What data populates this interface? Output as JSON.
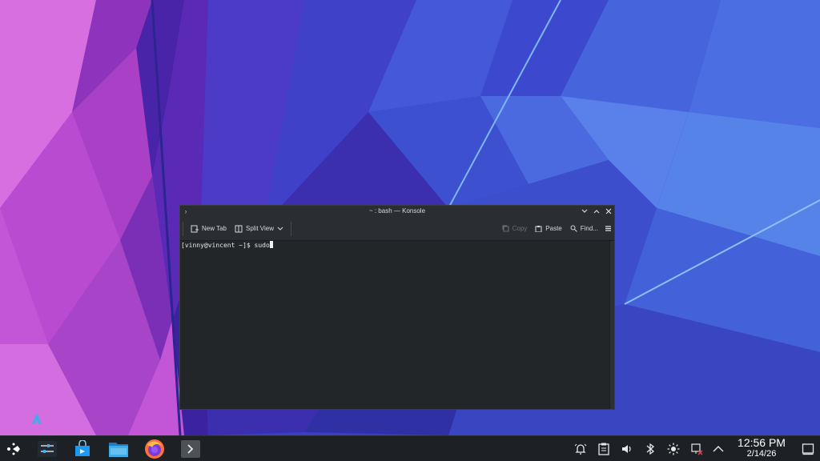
{
  "desktop": {
    "wallpaper_icon": "kde-plasma-wallpaper"
  },
  "window": {
    "title": "~ : bash — Konsole",
    "toolbar": {
      "new_tab": "New Tab",
      "split_view": "Split View",
      "copy": "Copy",
      "paste": "Paste",
      "find": "Find..."
    },
    "terminal": {
      "prompt": "[vinny@vincent ~]$ ",
      "input": "sudo"
    }
  },
  "taskbar": {
    "apps": [
      {
        "name": "application-launcher",
        "icon": "steamdeck-launcher-icon"
      },
      {
        "name": "system-settings",
        "icon": "settings-sliders-icon"
      },
      {
        "name": "discover",
        "icon": "shopping-bag-icon"
      },
      {
        "name": "dolphin",
        "icon": "folder-icon"
      },
      {
        "name": "firefox",
        "icon": "firefox-icon"
      },
      {
        "name": "konsole",
        "icon": "terminal-icon"
      }
    ],
    "clock": {
      "time": "12:56 PM",
      "date": "2/14/26"
    }
  },
  "colors": {
    "taskbar_bg": "#1d2024",
    "window_bg": "#232629",
    "accent": "#3daee9"
  }
}
